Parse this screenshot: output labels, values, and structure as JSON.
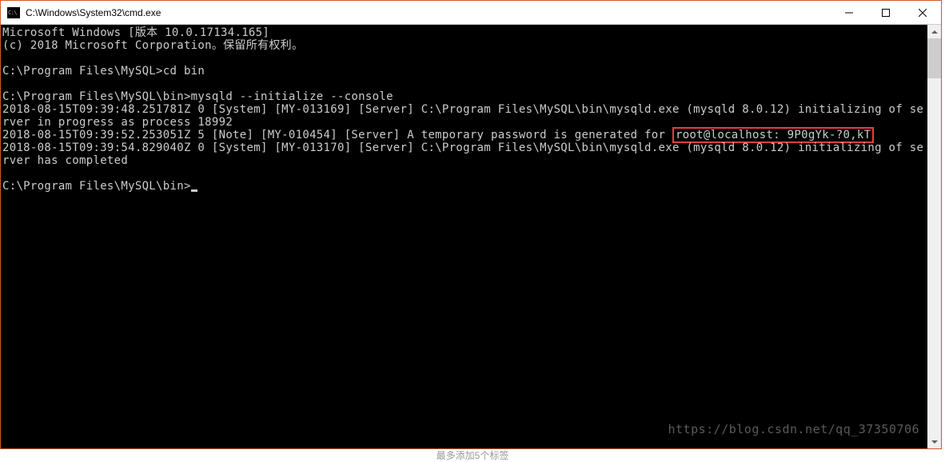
{
  "titlebar": {
    "title": "C:\\Windows\\System32\\cmd.exe"
  },
  "terminal": {
    "l1": "Microsoft Windows [版本 10.0.17134.165]",
    "l2": "(c) 2018 Microsoft Corporation。保留所有权利。",
    "l3": "",
    "l4": "C:\\Program Files\\MySQL>cd bin",
    "l5": "",
    "l6": "C:\\Program Files\\MySQL\\bin>mysqld --initialize --console",
    "l7": "2018-08-15T09:39:48.251781Z 0 [System] [MY-013169] [Server] C:\\Program Files\\MySQL\\bin\\mysqld.exe (mysqld 8.0.12) initializing of server in progress as process 18992",
    "l8a": "2018-08-15T09:39:52.253051Z 5 [Note] [MY-010454] [Server] A temporary password is generated for ",
    "l8h": "root@localhost: 9P0gYk-?0,kT",
    "l9": "2018-08-15T09:39:54.829040Z 0 [System] [MY-013170] [Server] C:\\Program Files\\MySQL\\bin\\mysqld.exe (mysqld 8.0.12) initializing of server has completed",
    "l10": "",
    "l11": "C:\\Program Files\\MySQL\\bin>"
  },
  "watermark": "https://blog.csdn.net/qq_37350706",
  "footer": "最多添加5个标签"
}
